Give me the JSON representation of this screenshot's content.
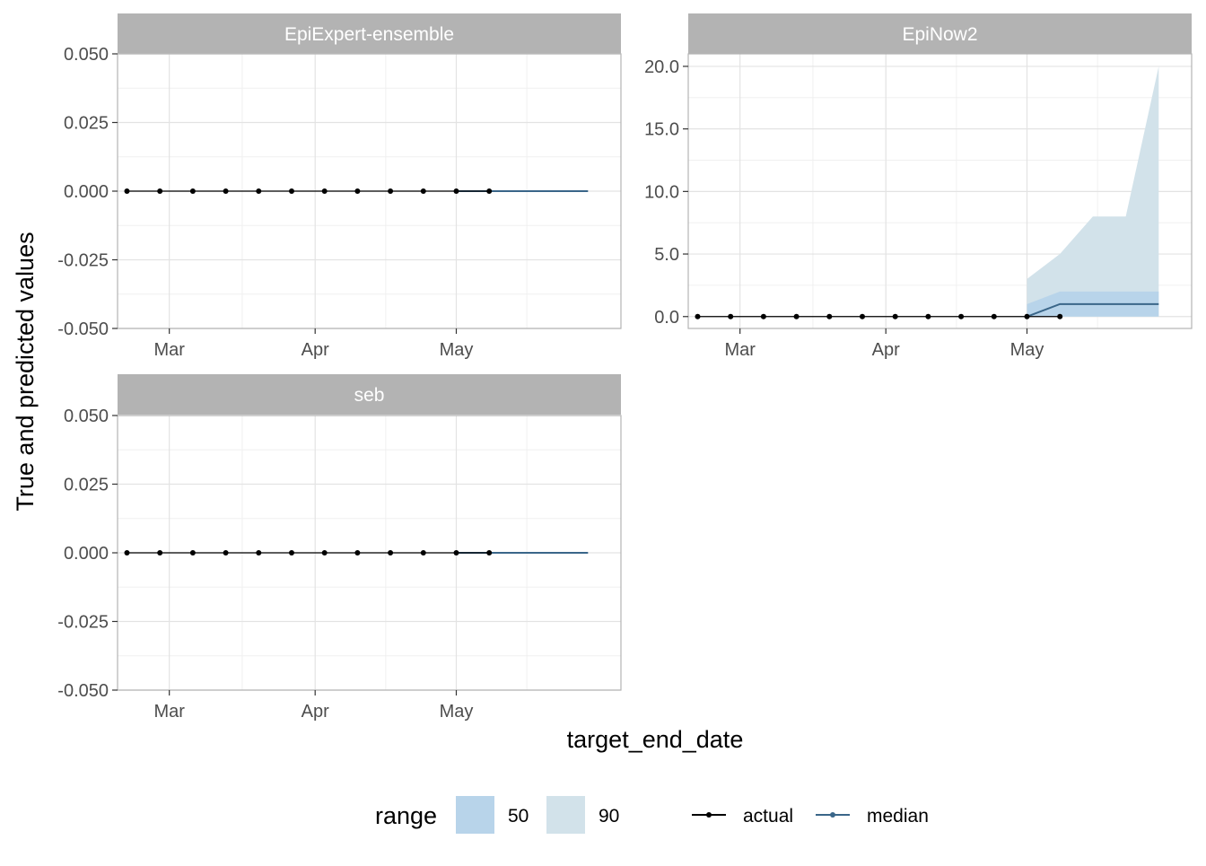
{
  "chart_data": {
    "type": "line",
    "ylabel": "True and predicted values",
    "xlabel": "target_end_date",
    "x_ticks": [
      {
        "date": "2021-03-01",
        "label": "Mar"
      },
      {
        "date": "2021-04-01",
        "label": "Apr"
      },
      {
        "date": "2021-05-01",
        "label": "May"
      }
    ],
    "xlim": [
      "2021-02-18",
      "2021-06-05"
    ],
    "grid": true,
    "legend": {
      "position": "bottom",
      "range_title": "range",
      "range_items": [
        {
          "label": "50",
          "color": "#b8d4ea"
        },
        {
          "label": "90",
          "color": "#d2e2ea"
        }
      ],
      "line_items": [
        {
          "label": "actual",
          "color": "#000000"
        },
        {
          "label": "median",
          "color": "#3a6689"
        }
      ]
    },
    "colors": {
      "strip_bg": "#b3b3b3",
      "strip_text": "#ffffff",
      "actual": "#000000",
      "median": "#3a6689",
      "range_50": "#b8d4ea",
      "range_90": "#d2e2ea"
    },
    "panels": [
      {
        "title": "EpiExpert-ensemble",
        "ylim": [
          -0.05,
          0.05
        ],
        "yticks": [
          -0.05,
          -0.025,
          0,
          0.025,
          0.05
        ],
        "ytick_labels": [
          "-0.050",
          "-0.025",
          "0.000",
          "0.025",
          "0.050"
        ],
        "actual": {
          "dates": [
            "2021-02-20",
            "2021-02-27",
            "2021-03-06",
            "2021-03-13",
            "2021-03-20",
            "2021-03-27",
            "2021-04-03",
            "2021-04-10",
            "2021-04-17",
            "2021-04-24",
            "2021-05-01",
            "2021-05-08"
          ],
          "values": [
            0,
            0,
            0,
            0,
            0,
            0,
            0,
            0,
            0,
            0,
            0,
            0
          ]
        },
        "median": {
          "dates": [
            "2021-05-01",
            "2021-05-08",
            "2021-05-15",
            "2021-05-22",
            "2021-05-29"
          ],
          "values": [
            0,
            0,
            0,
            0,
            0
          ]
        },
        "range_90": null,
        "range_50": null
      },
      {
        "title": "EpiNow2",
        "ylim": [
          -0.95,
          21.0
        ],
        "yticks": [
          0,
          5,
          10,
          15,
          20
        ],
        "ytick_labels": [
          "0.0",
          "5.0",
          "10.0",
          "15.0",
          "20.0"
        ],
        "actual": {
          "dates": [
            "2021-02-20",
            "2021-02-27",
            "2021-03-06",
            "2021-03-13",
            "2021-03-20",
            "2021-03-27",
            "2021-04-03",
            "2021-04-10",
            "2021-04-17",
            "2021-04-24",
            "2021-05-01",
            "2021-05-08"
          ],
          "values": [
            0,
            0,
            0,
            0,
            0,
            0,
            0,
            0,
            0,
            0,
            0,
            0
          ]
        },
        "median": {
          "dates": [
            "2021-05-01",
            "2021-05-08",
            "2021-05-15",
            "2021-05-22",
            "2021-05-29"
          ],
          "values": [
            0,
            1,
            1,
            1,
            1
          ]
        },
        "range_90": {
          "dates": [
            "2021-05-01",
            "2021-05-08",
            "2021-05-15",
            "2021-05-22",
            "2021-05-29"
          ],
          "lower": [
            0,
            0,
            0,
            0,
            0
          ],
          "upper": [
            3,
            5,
            8,
            8,
            20
          ]
        },
        "range_50": {
          "dates": [
            "2021-05-01",
            "2021-05-08",
            "2021-05-15",
            "2021-05-22",
            "2021-05-29"
          ],
          "lower": [
            0,
            0,
            0,
            0,
            0
          ],
          "upper": [
            1,
            2,
            2,
            2,
            2
          ]
        }
      },
      {
        "title": "seb",
        "ylim": [
          -0.05,
          0.05
        ],
        "yticks": [
          -0.05,
          -0.025,
          0,
          0.025,
          0.05
        ],
        "ytick_labels": [
          "-0.050",
          "-0.025",
          "0.000",
          "0.025",
          "0.050"
        ],
        "actual": {
          "dates": [
            "2021-02-20",
            "2021-02-27",
            "2021-03-06",
            "2021-03-13",
            "2021-03-20",
            "2021-03-27",
            "2021-04-03",
            "2021-04-10",
            "2021-04-17",
            "2021-04-24",
            "2021-05-01",
            "2021-05-08"
          ],
          "values": [
            0,
            0,
            0,
            0,
            0,
            0,
            0,
            0,
            0,
            0,
            0,
            0
          ]
        },
        "median": {
          "dates": [
            "2021-05-01",
            "2021-05-08",
            "2021-05-15",
            "2021-05-22",
            "2021-05-29"
          ],
          "values": [
            0,
            0,
            0,
            0,
            0
          ]
        },
        "range_90": null,
        "range_50": null
      }
    ]
  }
}
